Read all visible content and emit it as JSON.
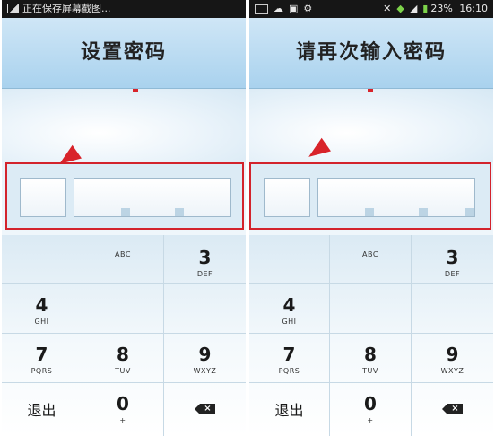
{
  "left_screen": {
    "status": {
      "text": "正在保存屏幕截图..."
    },
    "title": "设置密码",
    "keys": [
      {
        "digit": "",
        "letters": ""
      },
      {
        "digit": "",
        "letters": "ABC"
      },
      {
        "digit": "3",
        "letters": "DEF"
      },
      {
        "digit": "4",
        "letters": "GHI"
      },
      {
        "digit": "",
        "letters": ""
      },
      {
        "digit": "",
        "letters": ""
      },
      {
        "digit": "7",
        "letters": "PQRS"
      },
      {
        "digit": "8",
        "letters": "TUV"
      },
      {
        "digit": "9",
        "letters": "WXYZ"
      },
      {
        "label": "退出"
      },
      {
        "digit": "0",
        "letters": "+"
      },
      {
        "icon": "backspace-icon"
      }
    ]
  },
  "right_screen": {
    "status": {
      "battery": "23%",
      "time": "16:10"
    },
    "title": "请再次输入密码",
    "keys": [
      {
        "digit": "",
        "letters": ""
      },
      {
        "digit": "",
        "letters": "ABC"
      },
      {
        "digit": "3",
        "letters": "DEF"
      },
      {
        "digit": "4",
        "letters": "GHI"
      },
      {
        "digit": "",
        "letters": ""
      },
      {
        "digit": "",
        "letters": ""
      },
      {
        "digit": "7",
        "letters": "PQRS"
      },
      {
        "digit": "8",
        "letters": "TUV"
      },
      {
        "digit": "9",
        "letters": "WXYZ"
      },
      {
        "label": "退出"
      },
      {
        "digit": "0",
        "letters": "+"
      },
      {
        "icon": "backspace-icon"
      }
    ]
  },
  "colors": {
    "highlight_border": "#d3232c",
    "arrow": "#d8232a",
    "header": "#a9d2ee"
  }
}
